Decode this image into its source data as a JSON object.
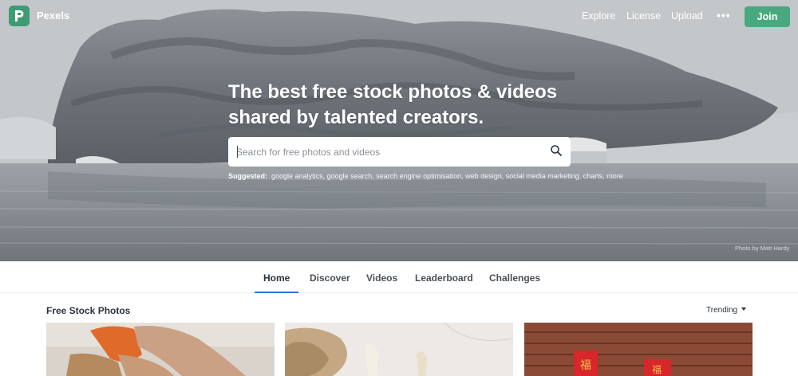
{
  "brand": {
    "name": "Pexels",
    "logo_letter": "P"
  },
  "nav": {
    "links": [
      "Explore",
      "License",
      "Upload"
    ],
    "more_icon": "more-icon",
    "join_label": "Join"
  },
  "hero": {
    "title_line1": "The best free stock photos & videos",
    "title_line2": "shared by talented creators.",
    "search_placeholder": "Search for free photos and videos",
    "suggested_label": "Suggested:",
    "suggestions": "google analytics, google search, search engine optimisation, web design, social media marketing, charts, more",
    "credit": "Photo by Matt Hardy"
  },
  "tabs": [
    "Home",
    "Discover",
    "Videos",
    "Leaderboard",
    "Challenges"
  ],
  "active_tab": "Home",
  "section": {
    "title": "Free Stock Photos",
    "sort_label": "Trending"
  },
  "colors": {
    "brand_green": "#48a97f",
    "tab_accent": "#2c6fd8"
  }
}
